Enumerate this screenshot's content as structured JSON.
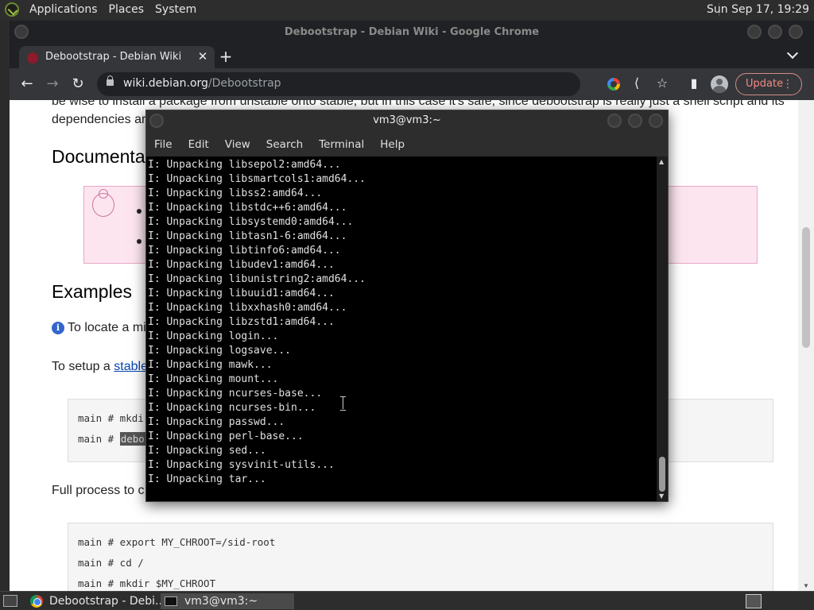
{
  "panel": {
    "menus": [
      "Applications",
      "Places",
      "System"
    ],
    "clock": "Sun Sep 17, 19:29"
  },
  "chrome": {
    "window_title": "Debootstrap - Debian Wiki - Google Chrome",
    "tab_title": "Debootstrap - Debian Wiki",
    "new_tab": "+",
    "url_host": "wiki.debian.org",
    "url_path": "/Debootstrap",
    "update_label": "Update"
  },
  "page": {
    "intro_line1": "be wise to install a package from unstable onto stable, but in this case it's safe, since debootstrap is really just a shell script and its",
    "intro_line2": "dependencies ar",
    "heading_documentation": "Documentat",
    "heading_examples": "Examples",
    "locate_text": "To locate a mi",
    "setup_text_prefix": "To setup a ",
    "setup_link": "stable",
    "code1_line1": "main # mkdir",
    "code1_line2_prefix": "main # ",
    "code1_line2_highlight": "debo",
    "full_process_text": "Full process to c",
    "code2_lines": [
      "main # export MY_CHROOT=/sid-root",
      "main # cd /",
      "main # mkdir $MY_CHROOT"
    ]
  },
  "terminal": {
    "title": "vm3@vm3:~",
    "menu": [
      "File",
      "Edit",
      "View",
      "Search",
      "Terminal",
      "Help"
    ],
    "lines": [
      "I: Unpacking libsepol2:amd64...",
      "I: Unpacking libsmartcols1:amd64...",
      "I: Unpacking libss2:amd64...",
      "I: Unpacking libstdc++6:amd64...",
      "I: Unpacking libsystemd0:amd64...",
      "I: Unpacking libtasn1-6:amd64...",
      "I: Unpacking libtinfo6:amd64...",
      "I: Unpacking libudev1:amd64...",
      "I: Unpacking libunistring2:amd64...",
      "I: Unpacking libuuid1:amd64...",
      "I: Unpacking libxxhash0:amd64...",
      "I: Unpacking libzstd1:amd64...",
      "I: Unpacking login...",
      "I: Unpacking logsave...",
      "I: Unpacking mawk...",
      "I: Unpacking mount...",
      "I: Unpacking ncurses-base...",
      "I: Unpacking ncurses-bin...",
      "I: Unpacking passwd...",
      "I: Unpacking perl-base...",
      "I: Unpacking sed...",
      "I: Unpacking sysvinit-utils...",
      "I: Unpacking tar..."
    ]
  },
  "taskbar": {
    "chrome_task": "Debootstrap - Debi...",
    "terminal_task": "vm3@vm3:~"
  },
  "icons": {
    "back": "arrow-left-icon",
    "forward": "arrow-right-icon",
    "reload": "reload-icon",
    "share": "share-icon",
    "bookmark": "star-icon",
    "sidepanel": "side-panel-icon",
    "menu": "kebab-menu-icon"
  },
  "colors": {
    "update_accent": "#f28b82",
    "link": "#0645ad",
    "note_bg": "#fde5f0",
    "terminal_bg": "#000000"
  }
}
